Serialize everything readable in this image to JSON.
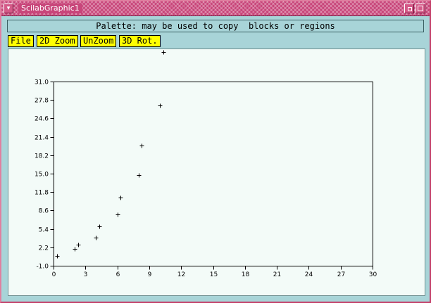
{
  "window": {
    "title": "ScilabGraphic1"
  },
  "status": {
    "message": "Palette: may be used to copy  blocks or regions"
  },
  "toolbar": {
    "buttons": [
      "File",
      "2D Zoom",
      "UnZoom",
      "3D Rot."
    ]
  },
  "icons": {
    "menu": "window-menu-icon",
    "minimize": "minimize-icon",
    "maximize": "maximize-icon"
  },
  "colors": {
    "titlebar": "#c8467a",
    "background": "#a8d4d8",
    "button": "#ffff00",
    "plot_background": "#f3fbf8"
  },
  "chart_data": {
    "type": "scatter",
    "marker": "+",
    "title": "",
    "xlabel": "",
    "ylabel": "",
    "xlim": [
      0,
      30
    ],
    "ylim": [
      -1.0,
      31.0
    ],
    "x_ticks": [
      "0",
      "3",
      "6",
      "9",
      "12",
      "15",
      "18",
      "21",
      "24",
      "27",
      "30"
    ],
    "y_ticks": [
      "-1.0",
      "2.2",
      "5.4",
      "8.6",
      "11.8",
      "15.0",
      "18.2",
      "21.4",
      "24.6",
      "27.8",
      "31.0"
    ],
    "grid": false,
    "points": [
      {
        "x": 0.0,
        "y": -1.0
      },
      {
        "x": 0.3,
        "y": 0.7
      },
      {
        "x": 2.0,
        "y": 1.9
      },
      {
        "x": 2.3,
        "y": 2.7
      },
      {
        "x": 4.0,
        "y": 3.9
      },
      {
        "x": 4.3,
        "y": 5.9
      },
      {
        "x": 6.0,
        "y": 7.9
      },
      {
        "x": 6.3,
        "y": 10.9
      },
      {
        "x": 8.0,
        "y": 14.8
      },
      {
        "x": 8.3,
        "y": 19.9
      },
      {
        "x": 10.0,
        "y": 26.8
      },
      {
        "x": 10.3,
        "y": 36.1
      }
    ]
  }
}
